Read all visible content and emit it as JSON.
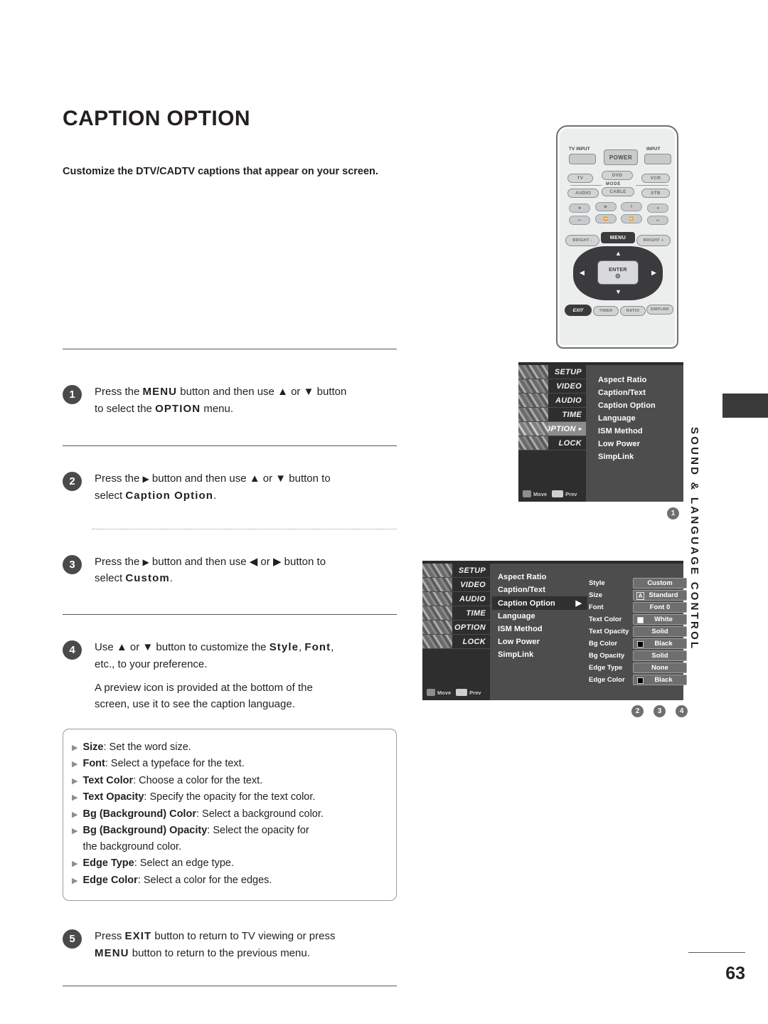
{
  "page": {
    "title": "CAPTION OPTION",
    "intro": "Customize the DTV/CADTV captions that appear on your screen.",
    "number": "63",
    "side_tab": "SOUND & LANGUAGE CONTROL"
  },
  "steps": [
    {
      "num": "1",
      "line1_a": "Press the ",
      "line1_b": "MENU",
      "line1_c": " button and then use ",
      "line1_up": "▲",
      "line1_d": " or ",
      "line1_down": "▼",
      "line1_e": " button",
      "line2_a": "to select the ",
      "line2_b": "OPTION",
      "line2_c": " menu."
    },
    {
      "num": "2",
      "line1_a": "Press the ",
      "line1_arrow": "▶",
      "line1_b": " button and then use ",
      "line1_up": "▲",
      "line1_c": " or ",
      "line1_down": "▼",
      "line1_d": " button to",
      "line2_a": "select ",
      "line2_b": "Caption Option",
      "line2_c": "."
    },
    {
      "num": "3",
      "line1_a": "Press the ",
      "line1_arrow": "▶",
      "line1_b": " button and then use ",
      "line1_left": "◀",
      "line1_c": " or ",
      "line1_right": "▶",
      "line1_d": " button to",
      "line2_a": "select ",
      "line2_b": "Custom",
      "line2_c": "."
    },
    {
      "num": "4",
      "line1_a": "Use ",
      "line1_up": "▲",
      "line1_b": " or ",
      "line1_down": "▼",
      "line1_c": " button to customize the ",
      "line1_style": "Style",
      "line1_d": ", ",
      "line1_font": "Font",
      "line1_e": ",",
      "line2": "etc., to your preference.",
      "line3": "A preview icon is provided at the bottom of the",
      "line4": "screen, use it to see the caption language."
    },
    {
      "num": "5",
      "line1_a": "Press ",
      "line1_b": "EXIT",
      "line1_c": " button to return to TV viewing or press",
      "line2_a": "MENU",
      "line2_b": " button to return to the previous menu."
    }
  ],
  "bullets": [
    {
      "marker": "▶",
      "term": "Size",
      "desc": ": Set the word size."
    },
    {
      "marker": "▶",
      "term": "Font",
      "desc": ": Select a typeface for the text."
    },
    {
      "marker": "▶",
      "term": "Text Color",
      "desc": ": Choose a color for the text."
    },
    {
      "marker": "▶",
      "term": "Text Opacity",
      "desc": ": Specify the opacity for the text color."
    },
    {
      "marker": "▶",
      "term": "Bg (Background) Color",
      "desc": ": Select a background color."
    },
    {
      "marker": "▶",
      "term": "Bg (Background) Opacity",
      "desc": ": Select the opacity for",
      "cont": "the background color."
    },
    {
      "marker": "▶",
      "term": "Edge Type",
      "desc": ": Select an edge type."
    },
    {
      "marker": "▶",
      "term": "Edge Color",
      "desc": ": Select a color for the edges."
    }
  ],
  "remote": {
    "tv_input_label": "TV INPUT",
    "input_label": "INPUT",
    "power": "POWER",
    "mode_label": "MODE",
    "mode_top": [
      "TV",
      "DVD",
      "VCR"
    ],
    "mode_bottom": [
      "AUDIO",
      "CABLE",
      "STB"
    ],
    "transport_row1": [
      "■",
      "▶",
      "‖",
      "●"
    ],
    "transport_row2": [
      "⏮",
      "⏪",
      "⏩",
      "⏭"
    ],
    "bright_minus": "BRIGHT -",
    "bright_plus": "BRIGHT +",
    "menu": "MENU",
    "enter": "ENTER",
    "enter_symbol": "◎",
    "nav_up": "▲",
    "nav_down": "▼",
    "nav_left": "◀",
    "nav_right": "▶",
    "exit": "EXIT",
    "bottom_buttons": [
      "TIMER",
      "RATIO",
      "SIMPLINK"
    ]
  },
  "osd": {
    "sidebar": [
      {
        "label": "SETUP",
        "active": false
      },
      {
        "label": "VIDEO",
        "active": false
      },
      {
        "label": "AUDIO",
        "active": false
      },
      {
        "label": "TIME",
        "active": false
      },
      {
        "label": "OPTION",
        "active": true,
        "arrow": "▸"
      },
      {
        "label": "LOCK",
        "active": false
      }
    ],
    "sidebar2": [
      {
        "label": "SETUP",
        "active": false
      },
      {
        "label": "VIDEO",
        "active": false
      },
      {
        "label": "AUDIO",
        "active": false
      },
      {
        "label": "TIME",
        "active": false
      },
      {
        "label": "OPTION",
        "active": false
      },
      {
        "label": "LOCK",
        "active": false
      }
    ],
    "hint_move": "Move",
    "hint_prev": "Prev",
    "menu_items": [
      {
        "label": "Aspect Ratio",
        "active": false
      },
      {
        "label": "Caption/Text",
        "active": false
      },
      {
        "label": "Caption Option",
        "active": false
      },
      {
        "label": "Language",
        "active": false
      },
      {
        "label": "ISM Method",
        "active": false
      },
      {
        "label": "Low Power",
        "active": false
      },
      {
        "label": "SimpLink",
        "active": false
      }
    ],
    "menu_items2": [
      {
        "label": "Aspect Ratio",
        "active": false,
        "arrow": ""
      },
      {
        "label": "Caption/Text",
        "active": false,
        "arrow": ""
      },
      {
        "label": "Caption Option",
        "active": true,
        "arrow": "▶"
      },
      {
        "label": "Language",
        "active": false,
        "arrow": ""
      },
      {
        "label": "ISM Method",
        "active": false,
        "arrow": ""
      },
      {
        "label": "Low Power",
        "active": false,
        "arrow": ""
      },
      {
        "label": "SimpLink",
        "active": false,
        "arrow": ""
      }
    ],
    "settings": [
      {
        "label": "Style",
        "value": "Custom",
        "swatch": "",
        "abox": ""
      },
      {
        "label": "Size",
        "value": "Standard",
        "swatch": "",
        "abox": "A"
      },
      {
        "label": "Font",
        "value": "Font  0",
        "swatch": "",
        "abox": ""
      },
      {
        "label": "Text Color",
        "value": "White",
        "swatch": "#ffffff",
        "abox": ""
      },
      {
        "label": "Text Opacity",
        "value": "Solid",
        "swatch": "",
        "abox": ""
      },
      {
        "label": "Bg Color",
        "value": "Black",
        "swatch": "#000000",
        "abox": ""
      },
      {
        "label": "Bg Opacity",
        "value": "Solid",
        "swatch": "",
        "abox": ""
      },
      {
        "label": "Edge Type",
        "value": "None",
        "swatch": "",
        "abox": ""
      },
      {
        "label": "Edge Color",
        "value": "Black",
        "swatch": "#000000",
        "abox": ""
      }
    ],
    "badge_top": "1",
    "badges_bottom": [
      "2",
      "3",
      "4"
    ]
  }
}
